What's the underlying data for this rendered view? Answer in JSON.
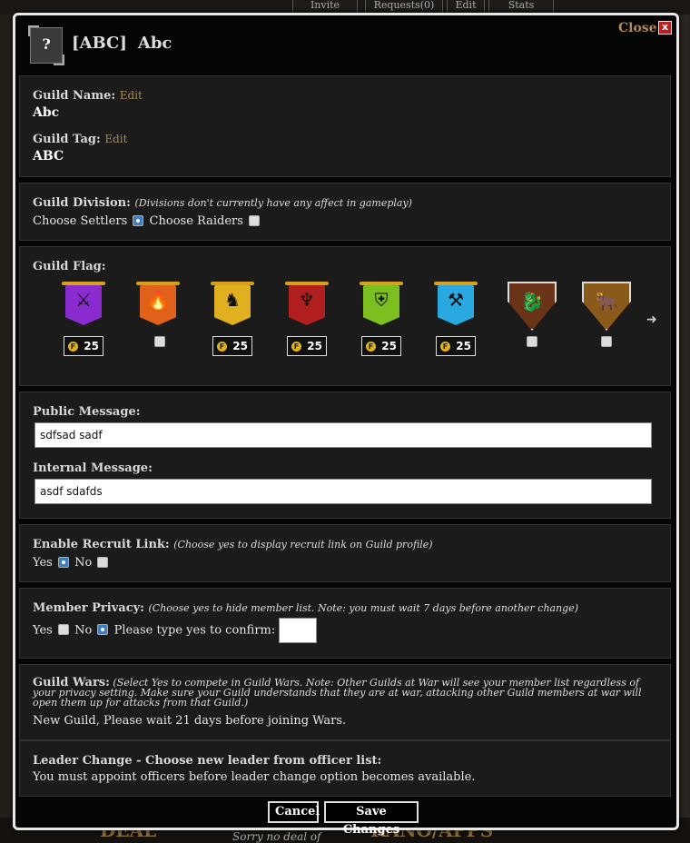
{
  "background": {
    "tabs": [
      "Invite",
      "Requests(0)",
      "Edit",
      "Stats"
    ],
    "bottom_promo_1": "DEAL",
    "bottom_promo_2": "KANO/APPS",
    "bottom_sorry": "Sorry no deal of"
  },
  "header": {
    "tag": "[ABC]",
    "name": "Abc",
    "icon_glyph": "?",
    "close_label": "Close",
    "close_x": "x"
  },
  "identity": {
    "guild_name_label": "Guild Name:",
    "guild_name_edit": "Edit",
    "guild_name_value": "Abc",
    "guild_tag_label": "Guild Tag:",
    "guild_tag_edit": "Edit",
    "guild_tag_value": "ABC"
  },
  "division": {
    "label": "Guild Division:",
    "note": "(Divisions don't currently have any affect in gameplay)",
    "settlers_label": "Choose Settlers",
    "raiders_label": "Choose Raiders",
    "selected": "settlers"
  },
  "flag": {
    "label": "Guild Flag:",
    "coin_letter": "F",
    "items": [
      {
        "style": "banner",
        "color": "#8a2bd0",
        "emblem": "⚔",
        "price": "25",
        "selectable": false
      },
      {
        "style": "banner",
        "color": "#e0621a",
        "emblem": "🔥",
        "price": "",
        "selectable": true
      },
      {
        "style": "banner",
        "color": "#e0b020",
        "emblem": "♞",
        "price": "25",
        "selectable": false
      },
      {
        "style": "banner",
        "color": "#b01e1e",
        "emblem": "♆",
        "price": "25",
        "selectable": false
      },
      {
        "style": "banner",
        "color": "#7cc020",
        "emblem": "⛨",
        "price": "25",
        "selectable": false
      },
      {
        "style": "banner",
        "color": "#2aa8e0",
        "emblem": "⚒",
        "price": "25",
        "selectable": false
      },
      {
        "style": "shield",
        "color": "#6a3418",
        "emblem": "🐉",
        "price": "",
        "selectable": true
      },
      {
        "style": "shield",
        "color": "#8a5a1a",
        "emblem": "🐂",
        "price": "",
        "selectable": true
      }
    ]
  },
  "messages": {
    "public_label": "Public Message:",
    "public_value": "sdfsad sadf",
    "internal_label": "Internal Message:",
    "internal_value": "asdf sdafds"
  },
  "recruit": {
    "label": "Enable Recruit Link:",
    "note": "(Choose yes to display recruit link on Guild profile)",
    "yes_label": "Yes",
    "no_label": "No",
    "selected": "yes"
  },
  "privacy": {
    "label": "Member Privacy:",
    "note": "(Choose yes to hide member list. Note: you must wait 7 days before another change)",
    "yes_label": "Yes",
    "no_label": "No",
    "confirm_label": "Please type yes to confirm:",
    "confirm_value": "",
    "selected": "no"
  },
  "wars": {
    "label": "Guild Wars:",
    "note": "(Select Yes to compete in Guild Wars. Note: Other Guilds at War will see your member list regardless of your privacy setting. Make sure your Guild understands that they are at war, attacking other Guild members at war will open them up for attacks from that Guild.)",
    "status": "New Guild, Please wait 21 days before joining Wars."
  },
  "leader": {
    "label": "Leader Change - Choose new leader from officer list:",
    "status": "You must appoint officers before leader change option becomes available."
  },
  "actions": {
    "cancel_label": "Cancel",
    "save_label": "Save Changes"
  }
}
